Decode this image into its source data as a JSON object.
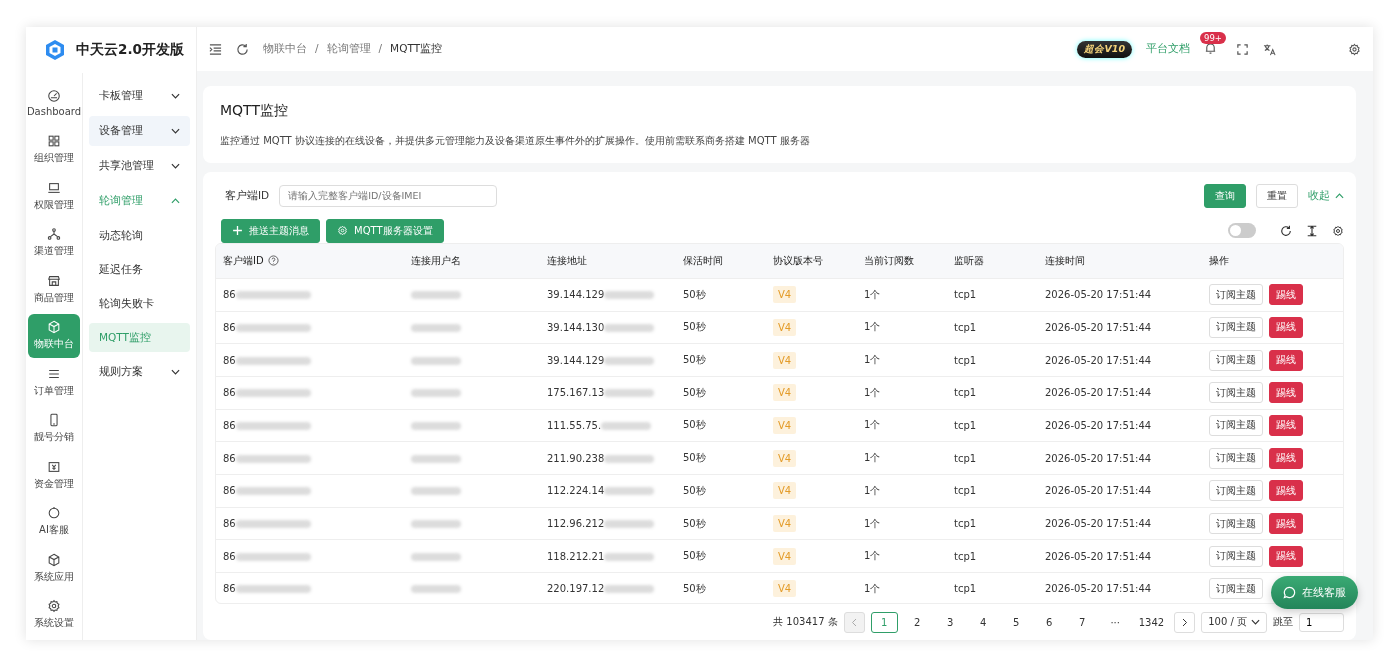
{
  "brand": {
    "name": "中天云2.0开发版"
  },
  "rail": [
    {
      "kind": "gauge",
      "label": "Dashboard",
      "selected": false
    },
    {
      "kind": "grid",
      "label": "组织管理",
      "selected": false
    },
    {
      "kind": "laptop",
      "label": "权限管理",
      "selected": false
    },
    {
      "kind": "network",
      "label": "渠道管理",
      "selected": false
    },
    {
      "kind": "store",
      "label": "商品管理",
      "selected": false
    },
    {
      "kind": "cube",
      "label": "物联中台",
      "selected": true
    },
    {
      "kind": "list",
      "label": "订单管理",
      "selected": false
    },
    {
      "kind": "phone",
      "label": "靓号分销",
      "selected": false
    },
    {
      "kind": "money",
      "label": "资金管理",
      "selected": false
    },
    {
      "kind": "bot",
      "label": "AI客服",
      "selected": false
    },
    {
      "kind": "cube",
      "label": "系统应用",
      "selected": false
    },
    {
      "kind": "gear",
      "label": "系统设置",
      "selected": false
    }
  ],
  "submenu": [
    {
      "label": "卡板管理",
      "expanded": false,
      "hovered": false
    },
    {
      "label": "设备管理",
      "expanded": false,
      "hovered": true
    },
    {
      "label": "共享池管理",
      "expanded": false,
      "hovered": false
    },
    {
      "label": "轮询管理",
      "expanded": true,
      "hovered": false,
      "children": [
        {
          "label": "动态轮询",
          "selected": false
        },
        {
          "label": "延迟任务",
          "selected": false
        },
        {
          "label": "轮询失败卡",
          "selected": false
        },
        {
          "label": "MQTT监控",
          "selected": true
        }
      ]
    },
    {
      "label": "规则方案",
      "expanded": false,
      "hovered": false
    }
  ],
  "breadcrumb": [
    {
      "label": "物联中台"
    },
    {
      "separator": "/",
      "label": "轮询管理"
    },
    {
      "separator": "/",
      "label": "MQTT监控"
    }
  ],
  "header": {
    "badge": "超会V10",
    "docs_link": "平台文档",
    "notifications": "99+"
  },
  "page": {
    "title": "MQTT监控",
    "description": "监控通过 MQTT 协议连接的在线设备，并提供多元管理能力及设备渠道原生事件外的扩展操作。使用前需联系商务搭建 MQTT 服务器"
  },
  "filter": {
    "label": "客户端ID",
    "placeholder": "请输入完整客户端ID/设备IMEI",
    "query_button": "查询",
    "reset_button": "重置",
    "collapse_link": "收起"
  },
  "toolbar": {
    "buttons": [
      "推送主题消息",
      "MQTT服务器设置"
    ],
    "toggle_on": false
  },
  "table": {
    "columns": [
      "客户端ID",
      "连接用户名",
      "连接地址",
      "保活时间",
      "协议版本号",
      "当前订阅数",
      "监听器",
      "连接时间",
      "操作"
    ],
    "rows": [
      {
        "client_id": "86",
        "address": "39.144.129",
        "keepalive": "50秒",
        "version": "V4",
        "subscriptions": "1个",
        "listener": "tcp1",
        "connected_at": "2026-05-20 17:51:44",
        "actions": [
          "订阅主题",
          "踢线"
        ]
      },
      {
        "client_id": "86",
        "address": "39.144.130",
        "keepalive": "50秒",
        "version": "V4",
        "subscriptions": "1个",
        "listener": "tcp1",
        "connected_at": "2026-05-20 17:51:44",
        "actions": [
          "订阅主题",
          "踢线"
        ]
      },
      {
        "client_id": "86",
        "address": "39.144.129",
        "keepalive": "50秒",
        "version": "V4",
        "subscriptions": "1个",
        "listener": "tcp1",
        "connected_at": "2026-05-20 17:51:44",
        "actions": [
          "订阅主题",
          "踢线"
        ]
      },
      {
        "client_id": "86",
        "address": "175.167.13",
        "keepalive": "50秒",
        "version": "V4",
        "subscriptions": "1个",
        "listener": "tcp1",
        "connected_at": "2026-05-20 17:51:44",
        "actions": [
          "订阅主题",
          "踢线"
        ]
      },
      {
        "client_id": "86",
        "address": "111.55.75.",
        "keepalive": "50秒",
        "version": "V4",
        "subscriptions": "1个",
        "listener": "tcp1",
        "connected_at": "2026-05-20 17:51:44",
        "actions": [
          "订阅主题",
          "踢线"
        ]
      },
      {
        "client_id": "86",
        "address": "211.90.238",
        "keepalive": "50秒",
        "version": "V4",
        "subscriptions": "1个",
        "listener": "tcp1",
        "connected_at": "2026-05-20 17:51:44",
        "actions": [
          "订阅主题",
          "踢线"
        ]
      },
      {
        "client_id": "86",
        "address": "112.224.14",
        "keepalive": "50秒",
        "version": "V4",
        "subscriptions": "1个",
        "listener": "tcp1",
        "connected_at": "2026-05-20 17:51:44",
        "actions": [
          "订阅主题",
          "踢线"
        ]
      },
      {
        "client_id": "86",
        "address": "112.96.212",
        "keepalive": "50秒",
        "version": "V4",
        "subscriptions": "1个",
        "listener": "tcp1",
        "connected_at": "2026-05-20 17:51:44",
        "actions": [
          "订阅主题",
          "踢线"
        ]
      },
      {
        "client_id": "86",
        "address": "118.212.21",
        "keepalive": "50秒",
        "version": "V4",
        "subscriptions": "1个",
        "listener": "tcp1",
        "connected_at": "2026-05-20 17:51:44",
        "actions": [
          "订阅主题",
          "踢线"
        ]
      },
      {
        "client_id": "86",
        "address": "220.197.12",
        "keepalive": "50秒",
        "version": "V4",
        "subscriptions": "1个",
        "listener": "tcp1",
        "connected_at": "2026-05-20 17:51:44",
        "actions": [
          "订阅主题"
        ]
      }
    ]
  },
  "pagination": {
    "total": "共 103417 条",
    "pages": [
      {
        "label": "1",
        "selected": true
      },
      {
        "label": "2",
        "selected": false
      },
      {
        "label": "3",
        "selected": false
      },
      {
        "label": "4",
        "selected": false
      },
      {
        "label": "5",
        "selected": false
      },
      {
        "label": "6",
        "selected": false
      },
      {
        "label": "7",
        "selected": false
      },
      {
        "label": "···",
        "selected": false
      },
      {
        "label": "1342",
        "selected": false
      }
    ],
    "page_size": "100 / 页",
    "jump_label": "跳至",
    "jump_value": "1"
  },
  "chat_button": "在线客服"
}
